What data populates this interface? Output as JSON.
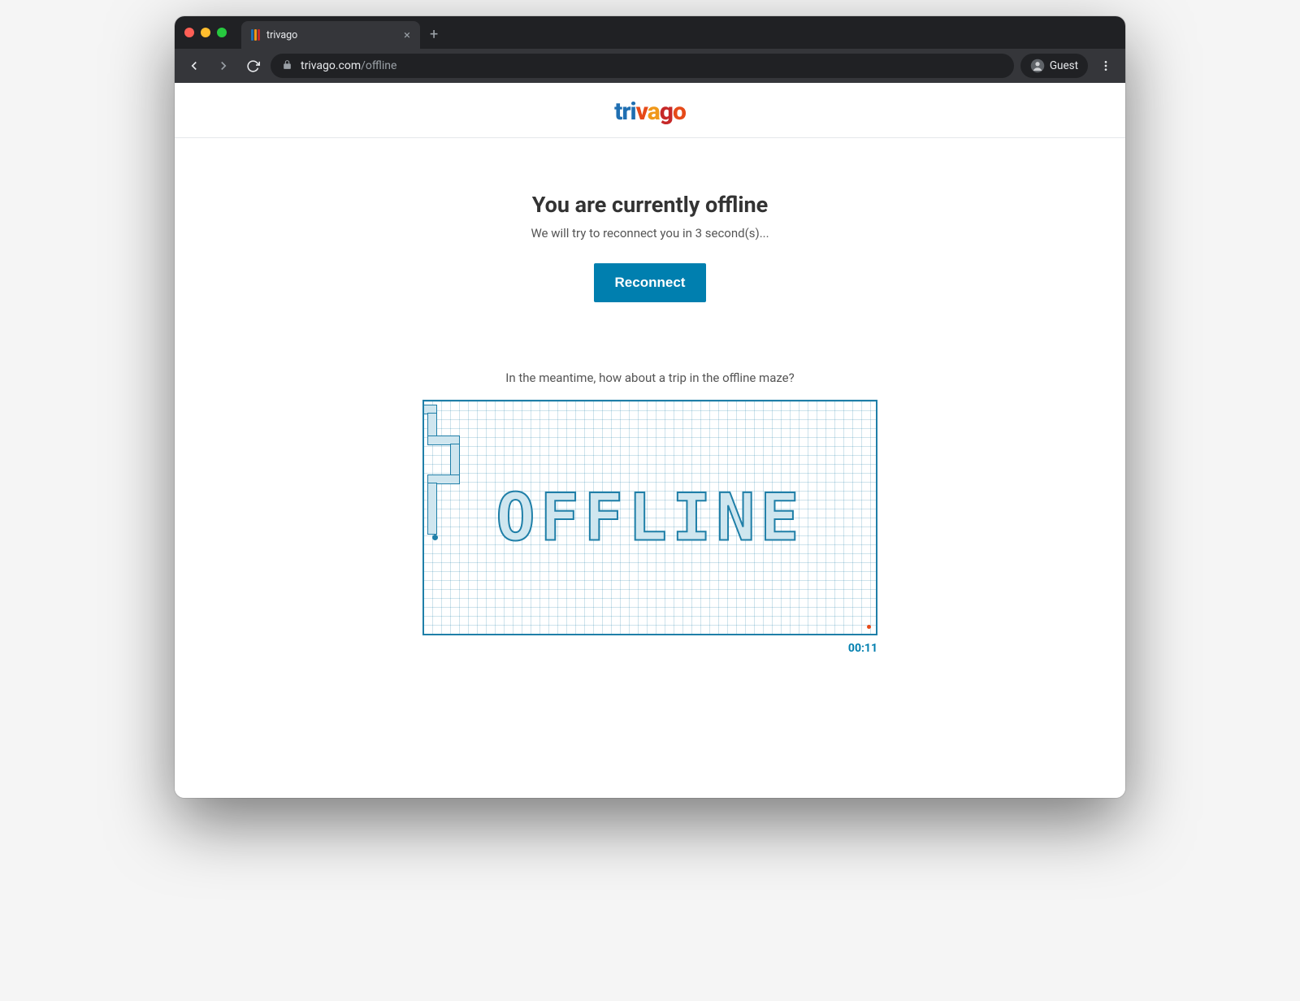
{
  "browser": {
    "tab_title": "trivago",
    "url_domain": "trivago.com",
    "url_path": "/offline",
    "guest_label": "Guest"
  },
  "page": {
    "brand_name": "trivago",
    "headline": "You are currently offline",
    "subtext": "We will try to reconnect you in 3 second(s)...",
    "reconnect_label": "Reconnect",
    "maze_caption": "In the meantime, how about a trip in the offline maze?",
    "maze_word": "OFFLINE",
    "timer": "00:11"
  }
}
